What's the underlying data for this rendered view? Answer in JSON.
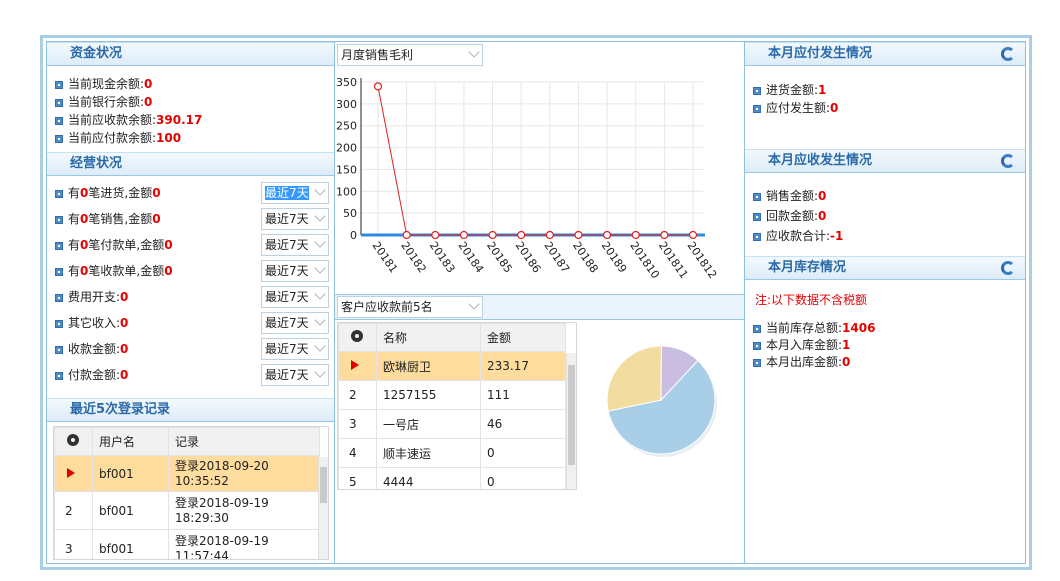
{
  "funds": {
    "title": "资金状况",
    "items": [
      {
        "label": "当前现金余额:",
        "value": "0"
      },
      {
        "label": "当前银行余额:",
        "value": "0"
      },
      {
        "label": "当前应收款余额:",
        "value": "390.17"
      },
      {
        "label": "当前应付款余额:",
        "value": "100"
      }
    ]
  },
  "operations": {
    "title": "经营状况",
    "items": [
      {
        "pre": "有",
        "num": "0",
        "mid": "笔进货,金额",
        "value": "0",
        "period": "最近7天"
      },
      {
        "pre": "有",
        "num": "0",
        "mid": "笔销售,金额",
        "value": "0",
        "period": "最近7天"
      },
      {
        "pre": "有",
        "num": "0",
        "mid": "笔付款单,金额",
        "value": "0",
        "period": "最近7天"
      },
      {
        "pre": "有",
        "num": "0",
        "mid": "笔收款单,金额",
        "value": "0",
        "period": "最近7天"
      },
      {
        "pre": "费用开支:",
        "num": "",
        "mid": "",
        "value": "0",
        "period": "最近7天"
      },
      {
        "pre": "其它收入:",
        "num": "",
        "mid": "",
        "value": "0",
        "period": "最近7天"
      },
      {
        "pre": "收款金额:",
        "num": "",
        "mid": "",
        "value": "0",
        "period": "最近7天"
      },
      {
        "pre": "付款金额:",
        "num": "",
        "mid": "",
        "value": "0",
        "period": "最近7天"
      }
    ]
  },
  "logins": {
    "title": "最近5次登录记录",
    "headers": [
      "用户名",
      "记录"
    ],
    "rows": [
      {
        "idx": "",
        "user": "bf001",
        "record": "登录2018-09-20 10:35:52"
      },
      {
        "idx": "2",
        "user": "bf001",
        "record": "登录2018-09-19 18:29:30"
      },
      {
        "idx": "3",
        "user": "bf001",
        "record": "登录2018-09-19 11:57:44"
      }
    ]
  },
  "sales_chart": {
    "selector": "月度销售毛利"
  },
  "chart_data": [
    {
      "type": "line",
      "x": [
        "20181",
        "20182",
        "20183",
        "20184",
        "20185",
        "20186",
        "20187",
        "20188",
        "20189",
        "201810",
        "201811",
        "201812"
      ],
      "series": [
        {
          "values": [
            340,
            0,
            0,
            0,
            0,
            0,
            0,
            0,
            0,
            0,
            0,
            0
          ]
        }
      ],
      "ylim": [
        0,
        350
      ],
      "yticks": [
        "0",
        "50",
        "100",
        "150",
        "200",
        "250",
        "300",
        "350"
      ],
      "grid": true
    },
    {
      "type": "pie",
      "categories": [
        "欧琳厨卫",
        "1257155",
        "一号店"
      ],
      "values": [
        233.17,
        111,
        46
      ],
      "colors": [
        "#a9cfe8",
        "#f3dca0",
        "#c9bde2"
      ]
    }
  ],
  "top_customers": {
    "selector": "客户应收款前5名",
    "headers": [
      "名称",
      "金额"
    ],
    "rows": [
      {
        "idx": "",
        "name": "欧琳厨卫",
        "amount": "233.17"
      },
      {
        "idx": "2",
        "name": "1257155",
        "amount": "111"
      },
      {
        "idx": "3",
        "name": "一号店",
        "amount": "46"
      },
      {
        "idx": "4",
        "name": "顺丰速运",
        "amount": "0"
      },
      {
        "idx": "5",
        "name": "4444",
        "amount": "0"
      }
    ]
  },
  "payables": {
    "title": "本月应付发生情况",
    "items": [
      {
        "label": "进货金额:",
        "value": "1"
      },
      {
        "label": "应付发生额:",
        "value": "0"
      }
    ]
  },
  "receivables": {
    "title": "本月应收发生情况",
    "items": [
      {
        "label": "销售金额:",
        "value": "0"
      },
      {
        "label": "回款金额:",
        "value": "0"
      },
      {
        "label": "应收款合计:",
        "value": "-1"
      }
    ]
  },
  "inventory": {
    "title": "本月库存情况",
    "note": "注:以下数据不含税额",
    "items": [
      {
        "label": "当前库存总额:",
        "value": "1406"
      },
      {
        "label": "本月入库金额:",
        "value": "1"
      },
      {
        "label": "本月出库金额:",
        "value": "0"
      }
    ]
  }
}
